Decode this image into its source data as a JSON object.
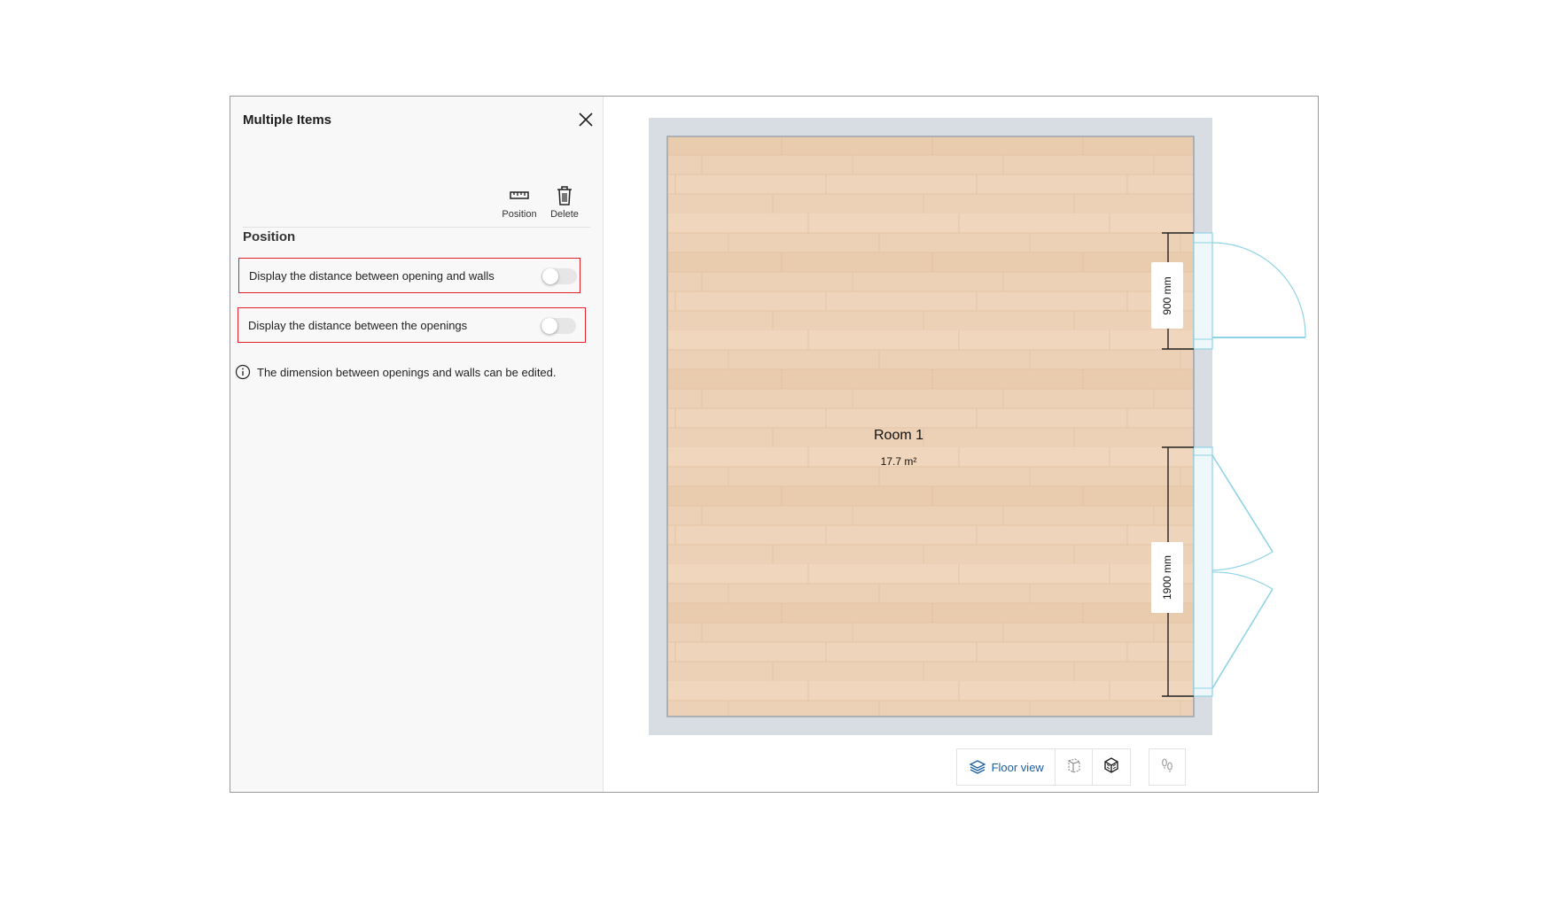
{
  "panel": {
    "title": "Multiple Items",
    "tools": [
      {
        "label": "Position",
        "icon": "ruler-icon"
      },
      {
        "label": "Delete",
        "icon": "trash-icon"
      }
    ],
    "section_heading": "Position",
    "toggles": [
      {
        "label": "Display the distance between opening and walls",
        "on": false
      },
      {
        "label": "Display the distance between the openings",
        "on": false
      }
    ],
    "info_text": "The dimension between openings and walls can be edited."
  },
  "floor_plan": {
    "room_name": "Room 1",
    "room_area": "17.7 m²",
    "dimensions": [
      "900 mm",
      "1900 mm"
    ]
  },
  "view_toolbar": {
    "floor_view_label": "Floor view",
    "buttons": [
      "floor-view-icon",
      "wall-view-icon",
      "3d-view-icon",
      "walk-icon"
    ]
  },
  "colors": {
    "highlight_border": "#e0202a",
    "wall_fill": "#d8dce3",
    "floor_wood": "#ecd0b4",
    "opening_stroke": "#8fd3e6",
    "link_blue": "#1c5fa0"
  }
}
